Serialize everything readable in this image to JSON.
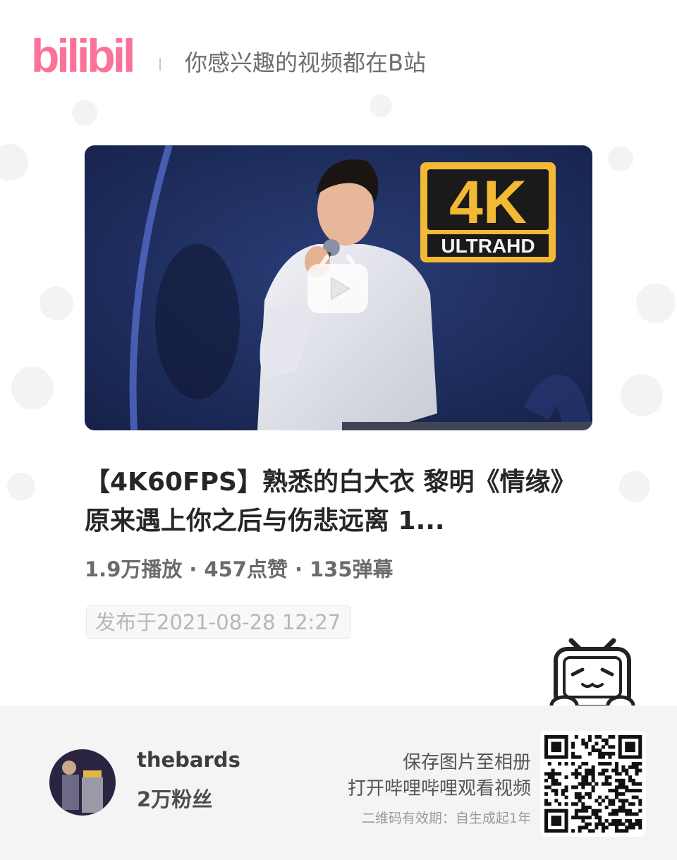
{
  "header": {
    "logo_text": "bilibili",
    "slogan": "你感兴趣的视频都在B站"
  },
  "video": {
    "badge_main": "4K",
    "badge_sub": "ULTRAHD",
    "title": "【4K60FPS】熟悉的白大衣 黎明《情缘》原来遇上你之后与伤悲远离 1...",
    "plays": "1.9万播放",
    "likes": "457点赞",
    "danmaku": "135弹幕",
    "separator": "·",
    "published": "发布于2021-08-28 12:27"
  },
  "uploader": {
    "name": "thebards",
    "fans": "2万粉丝"
  },
  "share": {
    "save_text": "保存图片至相册",
    "open_text": "打开哔哩哔哩观看视频",
    "validity": "二维码有效期：自生成起1年"
  },
  "colors": {
    "brand_pink": "#fb7299",
    "badge_gold": "#f3b934",
    "stage_blue": "#1d2d5e",
    "footer_bg": "#f4f4f4"
  },
  "icons": [
    "bilibili-logo",
    "play-icon",
    "tv-mascot-icon",
    "qr-code"
  ]
}
